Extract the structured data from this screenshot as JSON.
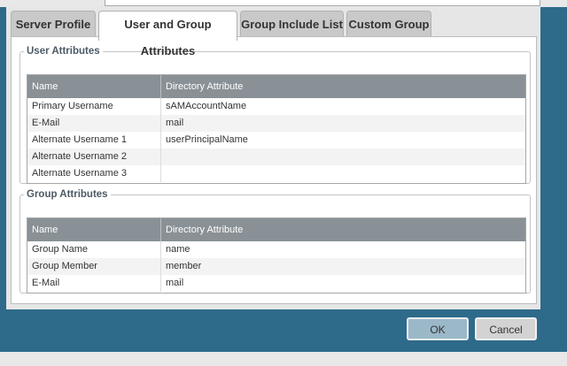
{
  "tabs": [
    {
      "label": "Server Profile"
    },
    {
      "label": "User and Group Attributes"
    },
    {
      "label": "Group Include List"
    },
    {
      "label": "Custom Group"
    }
  ],
  "user_attributes": {
    "legend": "User Attributes",
    "columns": [
      "Name",
      "Directory Attribute"
    ],
    "rows": [
      {
        "name": "Primary Username",
        "attr": "sAMAccountName"
      },
      {
        "name": "E-Mail",
        "attr": "mail"
      },
      {
        "name": "Alternate Username 1",
        "attr": "userPrincipalName"
      },
      {
        "name": "Alternate Username 2",
        "attr": ""
      },
      {
        "name": "Alternate Username 3",
        "attr": ""
      }
    ]
  },
  "group_attributes": {
    "legend": "Group Attributes",
    "columns": [
      "Name",
      "Directory Attribute"
    ],
    "rows": [
      {
        "name": "Group Name",
        "attr": "name"
      },
      {
        "name": "Group Member",
        "attr": "member"
      },
      {
        "name": "E-Mail",
        "attr": "mail"
      }
    ]
  },
  "buttons": {
    "ok": "OK",
    "cancel": "Cancel"
  },
  "colors": {
    "background": "#2e6a8a",
    "grid_header": "#8a9196",
    "ok_button": "#9bb8c9"
  }
}
